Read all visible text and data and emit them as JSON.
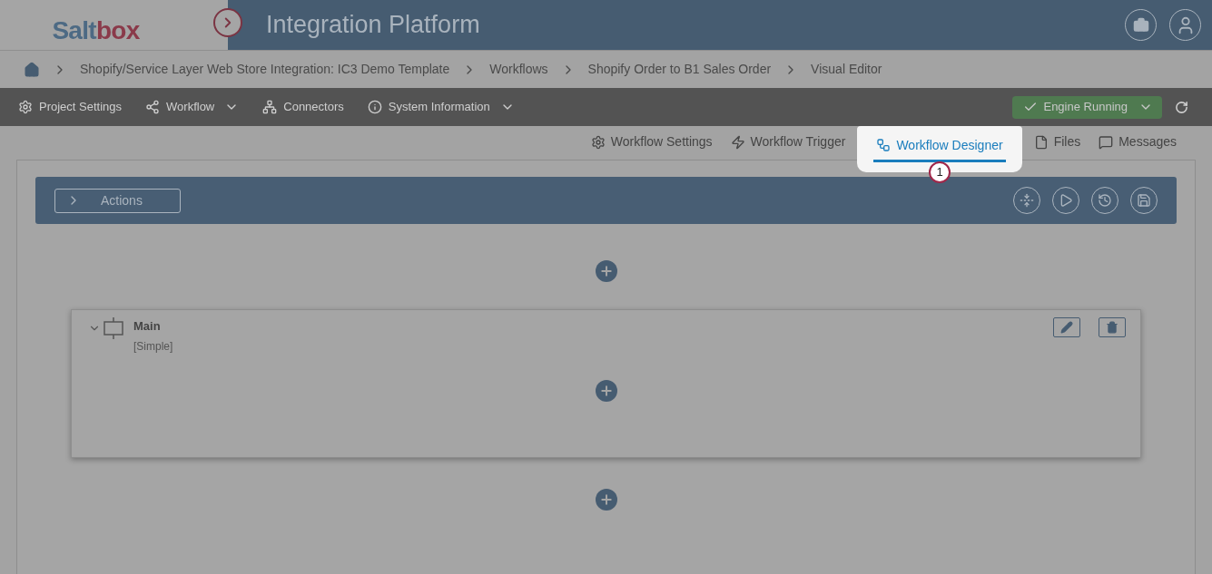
{
  "header": {
    "logo_parts": [
      "Salt",
      "box"
    ],
    "title": "Integration Platform"
  },
  "breadcrumb": [
    "Shopify/Service Layer Web Store Integration: IC3 Demo Template",
    "Workflows",
    "Shopify Order to B1 Sales Order",
    "Visual Editor"
  ],
  "toolbar": {
    "menus": [
      {
        "label": "Project Settings",
        "kind": "settings",
        "dropdown": false
      },
      {
        "label": "Workflow",
        "kind": "share",
        "dropdown": true
      },
      {
        "label": "Connectors",
        "kind": "network",
        "dropdown": false
      },
      {
        "label": "System Information",
        "kind": "info",
        "dropdown": true
      }
    ],
    "engine_status": "Engine Running"
  },
  "tabs": [
    {
      "label": "Workflow Settings",
      "kind": "settings",
      "selected": false
    },
    {
      "label": "Workflow Trigger",
      "kind": "trigger",
      "selected": false
    },
    {
      "label": "Workflow Designer",
      "kind": "designer",
      "selected": true
    },
    {
      "label": "Files",
      "kind": "file",
      "selected": false
    },
    {
      "label": "Messages",
      "kind": "message",
      "selected": false
    }
  ],
  "callout": "1",
  "actions_button": "Actions",
  "block": {
    "title": "Main",
    "subtitle": "[Simple]",
    "expanded": true
  }
}
